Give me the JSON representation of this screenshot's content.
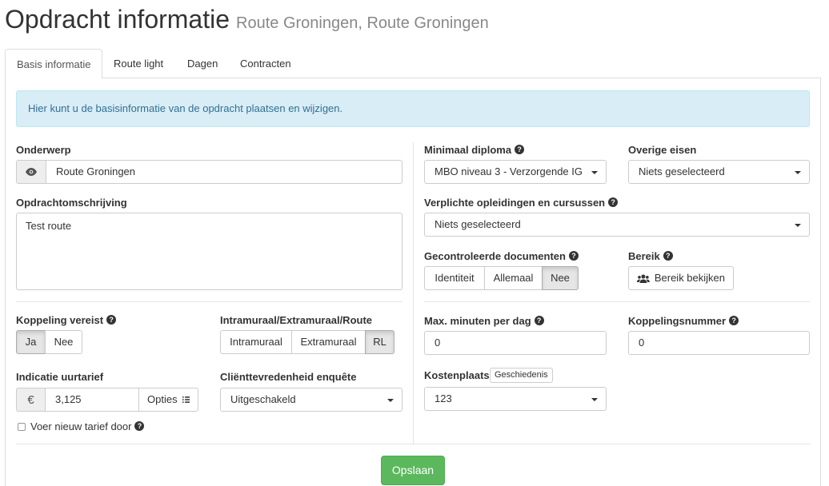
{
  "header": {
    "title": "Opdracht informatie",
    "subtitle": "Route Groningen, Route Groningen"
  },
  "tabs": [
    {
      "label": "Basis informatie",
      "active": true
    },
    {
      "label": "Route light",
      "active": false
    },
    {
      "label": "Dagen",
      "active": false
    },
    {
      "label": "Contracten",
      "active": false
    }
  ],
  "alert": {
    "text": "Hier kunt u de basisinformatie van de opdracht plaatsen en wijzigen."
  },
  "form": {
    "onderwerp": {
      "label": "Onderwerp",
      "value": "Route Groningen",
      "icon": "eye-icon"
    },
    "omschrijving": {
      "label": "Opdrachtomschrijving",
      "value": "Test route"
    },
    "koppeling": {
      "label": "Koppeling vereist",
      "options": [
        "Ja",
        "Nee"
      ],
      "selected": "Ja"
    },
    "intramuraal": {
      "label": "Intramuraal/Extramuraal/Route",
      "options": [
        "Intramuraal",
        "Extramuraal",
        "RL"
      ],
      "selected": "RL"
    },
    "uurtarief": {
      "label": "Indicatie uurtarief",
      "currency": "€",
      "value": "3,125",
      "options_label": "Opties"
    },
    "nieuw_tarief": {
      "label": "Voer nieuw tarief door",
      "checked": false
    },
    "enquete": {
      "label": "Cliënttevredenheid enquête",
      "value": "Uitgeschakeld"
    },
    "diploma": {
      "label": "Minimaal diploma",
      "value": "MBO niveau 3 - Verzorgende IG"
    },
    "overige_eisen": {
      "label": "Overige eisen",
      "value": "Niets geselecteerd"
    },
    "opleidingen": {
      "label": "Verplichte opleidingen en cursussen",
      "value": "Niets geselecteerd"
    },
    "documenten": {
      "label": "Gecontroleerde documenten",
      "options": [
        "Identiteit",
        "Allemaal",
        "Nee"
      ],
      "selected": "Nee"
    },
    "bereik": {
      "label": "Bereik",
      "button_label": "Bereik bekijken"
    },
    "max_minuten": {
      "label": "Max. minuten per dag",
      "value": "0"
    },
    "koppelingsnummer": {
      "label": "Koppelingsnummer",
      "value": "0"
    },
    "kostenplaats": {
      "label": "Kostenplaats",
      "history_label": "Geschiedenis",
      "value": "123"
    }
  },
  "save_label": "Opslaan",
  "colors": {
    "save_button": "#5cb85c",
    "alert_bg": "#d9edf7",
    "alert_text": "#31708f"
  }
}
